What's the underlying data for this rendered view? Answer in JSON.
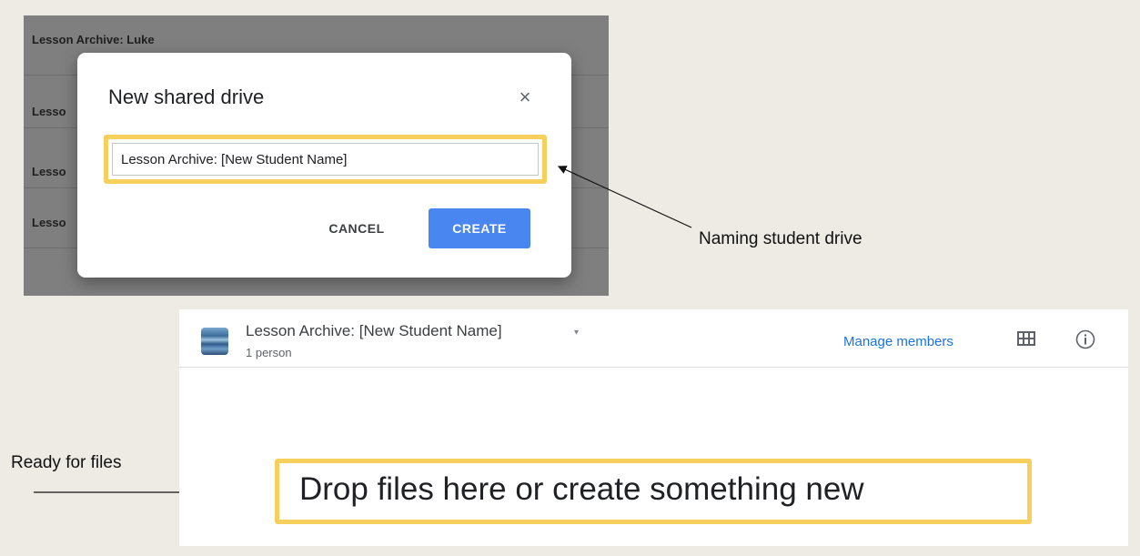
{
  "background_list": {
    "rows": [
      {
        "label": "Lesson Archive: Luke"
      },
      {
        "label": "Lesso"
      },
      {
        "label": "Lesso"
      },
      {
        "label": "Lesso"
      }
    ]
  },
  "modal": {
    "title": "New shared drive",
    "close_glyph": "×",
    "name_input_value": "Lesson Archive: [New Student Name]",
    "cancel_label": "CANCEL",
    "create_label": "CREATE"
  },
  "annotations": {
    "naming": "Naming student drive",
    "ready": "Ready for files"
  },
  "drive_view": {
    "name": "Lesson Archive: [New Student Name]",
    "caret": "▾",
    "members_count": "1 person",
    "manage_members_label": "Manage members",
    "drop_text": "Drop files here or create something new"
  },
  "colors": {
    "highlight": "#f6cf5d",
    "primary_button": "#4a86f0",
    "link": "#1a73e8",
    "overlay": "#7f7f7f",
    "canvas": "#eeebe4"
  },
  "icons": [
    "close-icon",
    "drive-thumbnail-icon",
    "grid-view-icon",
    "info-icon",
    "dropdown-caret-icon"
  ]
}
